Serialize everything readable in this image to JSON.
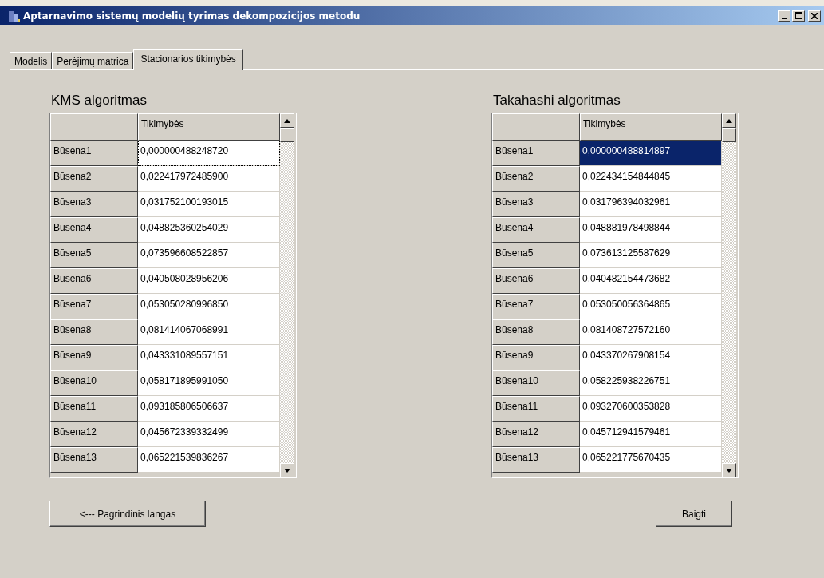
{
  "window": {
    "title": "Aptarnavimo sistemų modelių tyrimas dekompozicijos metodu"
  },
  "tabs": [
    {
      "label": "Modelis",
      "selected": false
    },
    {
      "label": "Perėjimų matrica",
      "selected": false
    },
    {
      "label": "Stacionarios tikimybės",
      "selected": true
    }
  ],
  "grids": [
    {
      "title": "KMS algoritmas",
      "column": "Tikimybės",
      "rows": [
        {
          "state": "Būsena1",
          "value": "0,000000488248720",
          "selected": false,
          "focused": true
        },
        {
          "state": "Būsena2",
          "value": "0,022417972485900",
          "selected": false,
          "focused": false
        },
        {
          "state": "Būsena3",
          "value": "0,031752100193015",
          "selected": false,
          "focused": false
        },
        {
          "state": "Būsena4",
          "value": "0,048825360254029",
          "selected": false,
          "focused": false
        },
        {
          "state": "Būsena5",
          "value": "0,073596608522857",
          "selected": false,
          "focused": false
        },
        {
          "state": "Būsena6",
          "value": "0,040508028956206",
          "selected": false,
          "focused": false
        },
        {
          "state": "Būsena7",
          "value": "0,053050280996850",
          "selected": false,
          "focused": false
        },
        {
          "state": "Būsena8",
          "value": "0,081414067068991",
          "selected": false,
          "focused": false
        },
        {
          "state": "Būsena9",
          "value": "0,043331089557151",
          "selected": false,
          "focused": false
        },
        {
          "state": "Būsena10",
          "value": "0,058171895991050",
          "selected": false,
          "focused": false
        },
        {
          "state": "Būsena11",
          "value": "0,093185806506637",
          "selected": false,
          "focused": false
        },
        {
          "state": "Būsena12",
          "value": "0,045672339332499",
          "selected": false,
          "focused": false
        },
        {
          "state": "Būsena13",
          "value": "0,065221539836267",
          "selected": false,
          "focused": false
        }
      ]
    },
    {
      "title": "Takahashi algoritmas",
      "column": "Tikimybės",
      "rows": [
        {
          "state": "Būsena1",
          "value": "0,000000488814897",
          "selected": true,
          "focused": false
        },
        {
          "state": "Būsena2",
          "value": "0,022434154844845",
          "selected": false,
          "focused": false
        },
        {
          "state": "Būsena3",
          "value": "0,031796394032961",
          "selected": false,
          "focused": false
        },
        {
          "state": "Būsena4",
          "value": "0,048881978498844",
          "selected": false,
          "focused": false
        },
        {
          "state": "Būsena5",
          "value": "0,073613125587629",
          "selected": false,
          "focused": false
        },
        {
          "state": "Būsena6",
          "value": "0,040482154473682",
          "selected": false,
          "focused": false
        },
        {
          "state": "Būsena7",
          "value": "0,053050056364865",
          "selected": false,
          "focused": false
        },
        {
          "state": "Būsena8",
          "value": "0,081408727572160",
          "selected": false,
          "focused": false
        },
        {
          "state": "Būsena9",
          "value": "0,043370267908154",
          "selected": false,
          "focused": false
        },
        {
          "state": "Būsena10",
          "value": "0,058225938226751",
          "selected": false,
          "focused": false
        },
        {
          "state": "Būsena11",
          "value": "0,093270600353828",
          "selected": false,
          "focused": false
        },
        {
          "state": "Būsena12",
          "value": "0,045712941579461",
          "selected": false,
          "focused": false
        },
        {
          "state": "Būsena13",
          "value": "0,065221775670435",
          "selected": false,
          "focused": false
        }
      ]
    }
  ],
  "buttons": [
    {
      "label": "<--- Pagrindinis langas"
    },
    {
      "label": "Baigti"
    }
  ]
}
